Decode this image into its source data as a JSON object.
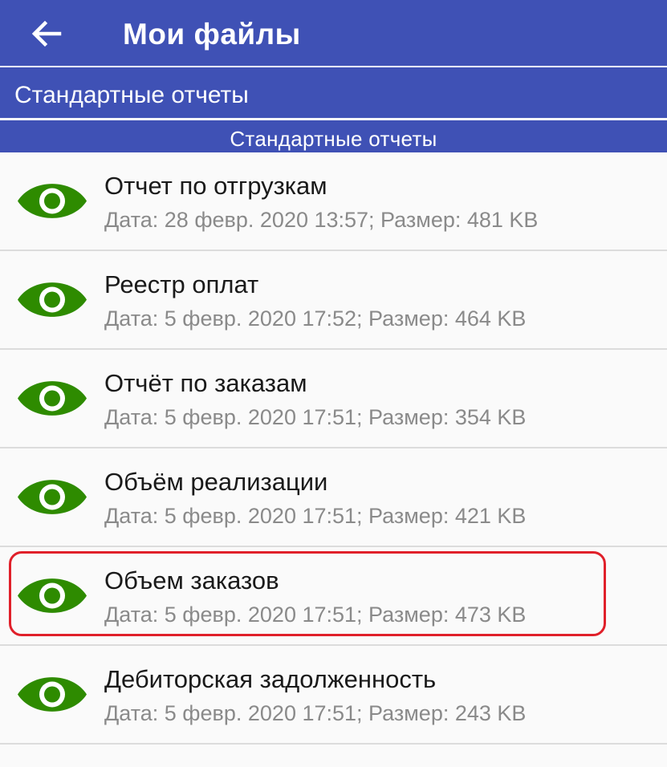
{
  "header": {
    "title": "Мои файлы",
    "back_icon": "arrow-left-icon",
    "color": "#3f51b5"
  },
  "section": {
    "label": "Стандартные отчеты"
  },
  "group": {
    "label": "Стандартные отчеты"
  },
  "files": [
    {
      "name": "Отчет по отгрузкам",
      "meta": "Дата: 28 февр. 2020 13:57; Размер: 481 KB",
      "icon": "eye-icon"
    },
    {
      "name": "Реестр оплат",
      "meta": "Дата: 5 февр. 2020 17:52; Размер: 464 KB",
      "icon": "eye-icon"
    },
    {
      "name": "Отчёт по заказам",
      "meta": "Дата: 5 февр. 2020 17:51; Размер: 354 KB",
      "icon": "eye-icon"
    },
    {
      "name": "Объём реализации",
      "meta": "Дата: 5 февр. 2020 17:51; Размер: 421 KB",
      "icon": "eye-icon"
    },
    {
      "name": "Объем заказов",
      "meta": "Дата: 5 февр. 2020 17:51; Размер: 473 KB",
      "icon": "eye-icon",
      "highlighted": true
    },
    {
      "name": "Дебиторская задолженность",
      "meta": "Дата: 5 февр. 2020 17:51; Размер: 243 KB",
      "icon": "eye-icon"
    }
  ],
  "colors": {
    "accent": "#3f51b5",
    "eye_icon": "#2e8b00",
    "highlight": "#e0202a"
  }
}
